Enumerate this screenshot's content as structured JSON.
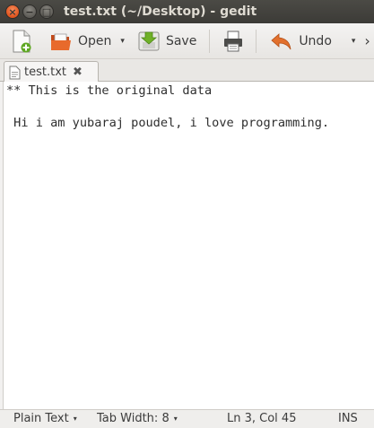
{
  "window": {
    "title": "test.txt (~/Desktop) - gedit",
    "controls": {
      "close": "×",
      "minimize": "−",
      "maximize": "□"
    }
  },
  "toolbar": {
    "new_icon": "new-document-icon",
    "open_label": "Open",
    "open_icon": "open-folder-icon",
    "save_label": "Save",
    "save_icon": "save-icon",
    "print_icon": "print-icon",
    "undo_label": "Undo",
    "undo_icon": "undo-arrow-icon",
    "caret": "▾"
  },
  "tabs": [
    {
      "label": "test.txt",
      "close": "✖",
      "icon": "text-file-icon"
    }
  ],
  "editor": {
    "lines": [
      "** This is the original data",
      "",
      " Hi i am yubaraj poudel, i love programming."
    ]
  },
  "statusbar": {
    "syntax": "Plain Text",
    "tab_width_label": "Tab Width:",
    "tab_width_value": "8",
    "position": "Ln 3, Col 45",
    "mode": "INS",
    "caret": "▾"
  },
  "colors": {
    "titlebar_bg": "#3c3b37",
    "close_button": "#e0541e",
    "editor_bg": "#ffffff",
    "text": "#2e2e2e"
  }
}
